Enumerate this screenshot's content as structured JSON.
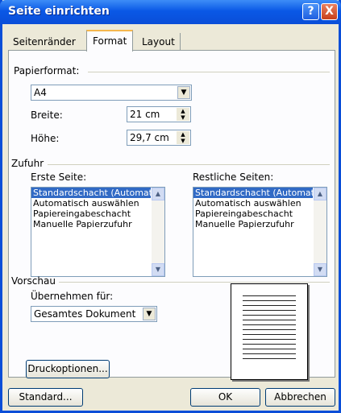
{
  "window": {
    "title": "Seite einrichten",
    "help_glyph": "?",
    "close_glyph": "X"
  },
  "tabs": [
    "Seitenränder",
    "Format",
    "Layout"
  ],
  "paper": {
    "section": "Papierformat:",
    "format_value": "A4",
    "width_label": "Breite:",
    "width_value": "21 cm",
    "height_label": "Höhe:",
    "height_value": "29,7 cm"
  },
  "feed": {
    "section": "Zufuhr",
    "first_label": "Erste Seite:",
    "rest_label": "Restliche Seiten:",
    "first_items": [
      "Standardschacht (Automatisc",
      "Automatisch auswählen",
      "Papiereingabeschacht",
      "Manuelle Papierzufuhr"
    ],
    "rest_items": [
      "Standardschacht (Automatisc",
      "Automatisch auswählen",
      "Papiereingabeschacht",
      "Manuelle Papierzufuhr"
    ]
  },
  "preview": {
    "section": "Vorschau",
    "apply_label": "Übernehmen für:",
    "apply_value": "Gesamtes Dokument"
  },
  "buttons": {
    "print_options": "Druckoptionen...",
    "default": "Standard...",
    "ok": "OK",
    "cancel": "Abbrechen"
  },
  "icons": {
    "dropdown": "chevron-down-icon",
    "spin": "spin-updown-icon",
    "scroll_up": "scroll-up-icon",
    "scroll_down": "scroll-down-icon"
  }
}
